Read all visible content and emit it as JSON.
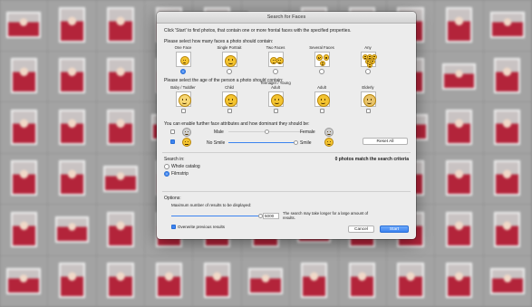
{
  "dialog": {
    "title": "Search for Faces",
    "intro": "Click 'Start' to find photos, that contain one or more frontal faces with the specified properties.",
    "count_prompt": "Please select how many faces a photo should contain:",
    "count_options": [
      {
        "label": "One Face",
        "selected": true
      },
      {
        "label": "Single Portrait",
        "selected": false
      },
      {
        "label": "Two Faces",
        "selected": false
      },
      {
        "label": "Several Faces",
        "selected": false
      },
      {
        "label": "Any",
        "selected": false
      }
    ],
    "age_prompt": "Please select the age of the person a photo should contain:",
    "age_options": [
      {
        "label": "Baby / Toddler",
        "checked": false
      },
      {
        "label": "Child",
        "checked": false
      },
      {
        "label": "Teenager / Young Adult",
        "checked": false
      },
      {
        "label": "Adult",
        "checked": false
      },
      {
        "label": "Elderly",
        "checked": false
      }
    ],
    "attr_prompt": "You can enable further face attributes and how dominant they should be:",
    "gender": {
      "checked": false,
      "left": "Male",
      "right": "Female",
      "level": 0.5
    },
    "smile": {
      "checked": true,
      "left": "No Smile",
      "right": "Smile",
      "level": 1.0
    },
    "reset_all": "Reset All",
    "search_in_label": "Search in:",
    "match_text": "0 photos match the search criteria",
    "scope_options": [
      {
        "label": "Whole catalog",
        "selected": false
      },
      {
        "label": "Filmstrip",
        "selected": true
      }
    ],
    "options_label": "Options:",
    "max_results_label": "Maximum number of results to be displayed:",
    "max_results_value": "5000",
    "max_results_level": 1.0,
    "max_results_note": "The search may take longer for a large amount of results.",
    "overwrite_label": "Overwrite previous results",
    "overwrite_checked": true,
    "cancel": "Cancel",
    "start": "Start"
  },
  "icons": {
    "count": [
      "single-face-icon",
      "single-portrait-icon",
      "two-faces-icon",
      "several-faces-icon",
      "any-faces-icon"
    ],
    "age": [
      "baby-face-icon",
      "child-face-icon",
      "teen-face-icon",
      "adult-face-icon",
      "elderly-face-icon"
    ]
  },
  "colors": {
    "accent": "#3b83f0",
    "photo_red": "#b3243a",
    "dialog_bg": "#ececec"
  }
}
